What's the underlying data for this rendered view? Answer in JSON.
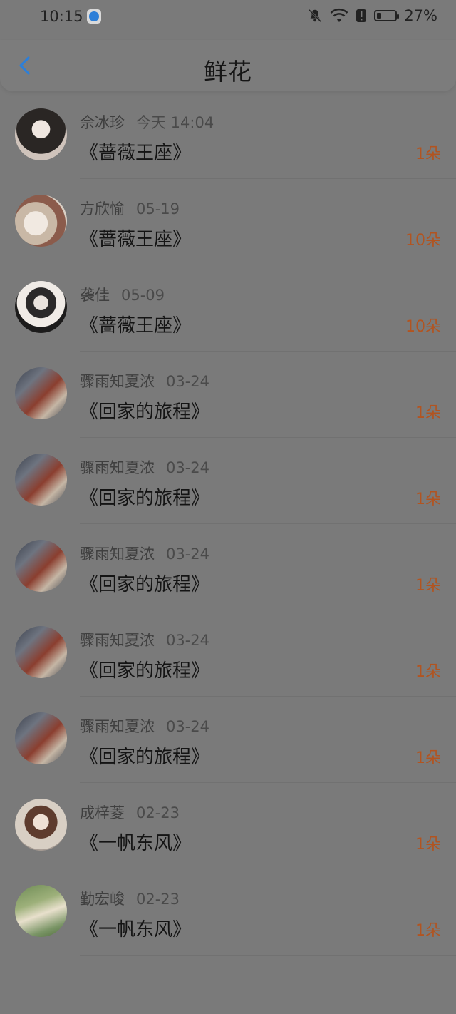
{
  "status_bar": {
    "time": "10:15",
    "battery_percent": "27%",
    "battery_level": 0.27,
    "icons": [
      "app-icon",
      "mute-bell-icon",
      "wifi-icon",
      "alert-icon",
      "battery-icon"
    ]
  },
  "header": {
    "title": "鲜花",
    "back_icon": "chevron-left-icon"
  },
  "colors": {
    "accent_back": "#2d7fd8",
    "count_color": "#b25420",
    "overlay_background": "#7a7a7a"
  },
  "gifts": [
    {
      "name": "佘冰珍",
      "date": "今天 14:04",
      "gift": "《蔷薇王座》",
      "count": "1朵"
    },
    {
      "name": "方欣愉",
      "date": "05-19",
      "gift": "《蔷薇王座》",
      "count": "10朵"
    },
    {
      "name": "袭佳",
      "date": "05-09",
      "gift": "《蔷薇王座》",
      "count": "10朵"
    },
    {
      "name": "骤雨知夏浓",
      "date": "03-24",
      "gift": "《回家的旅程》",
      "count": "1朵"
    },
    {
      "name": "骤雨知夏浓",
      "date": "03-24",
      "gift": "《回家的旅程》",
      "count": "1朵"
    },
    {
      "name": "骤雨知夏浓",
      "date": "03-24",
      "gift": "《回家的旅程》",
      "count": "1朵"
    },
    {
      "name": "骤雨知夏浓",
      "date": "03-24",
      "gift": "《回家的旅程》",
      "count": "1朵"
    },
    {
      "name": "骤雨知夏浓",
      "date": "03-24",
      "gift": "《回家的旅程》",
      "count": "1朵"
    },
    {
      "name": "成梓菱",
      "date": "02-23",
      "gift": "《一帆东风》",
      "count": "1朵"
    },
    {
      "name": "勤宏峻",
      "date": "02-23",
      "gift": "《一帆东风》",
      "count": "1朵"
    }
  ]
}
